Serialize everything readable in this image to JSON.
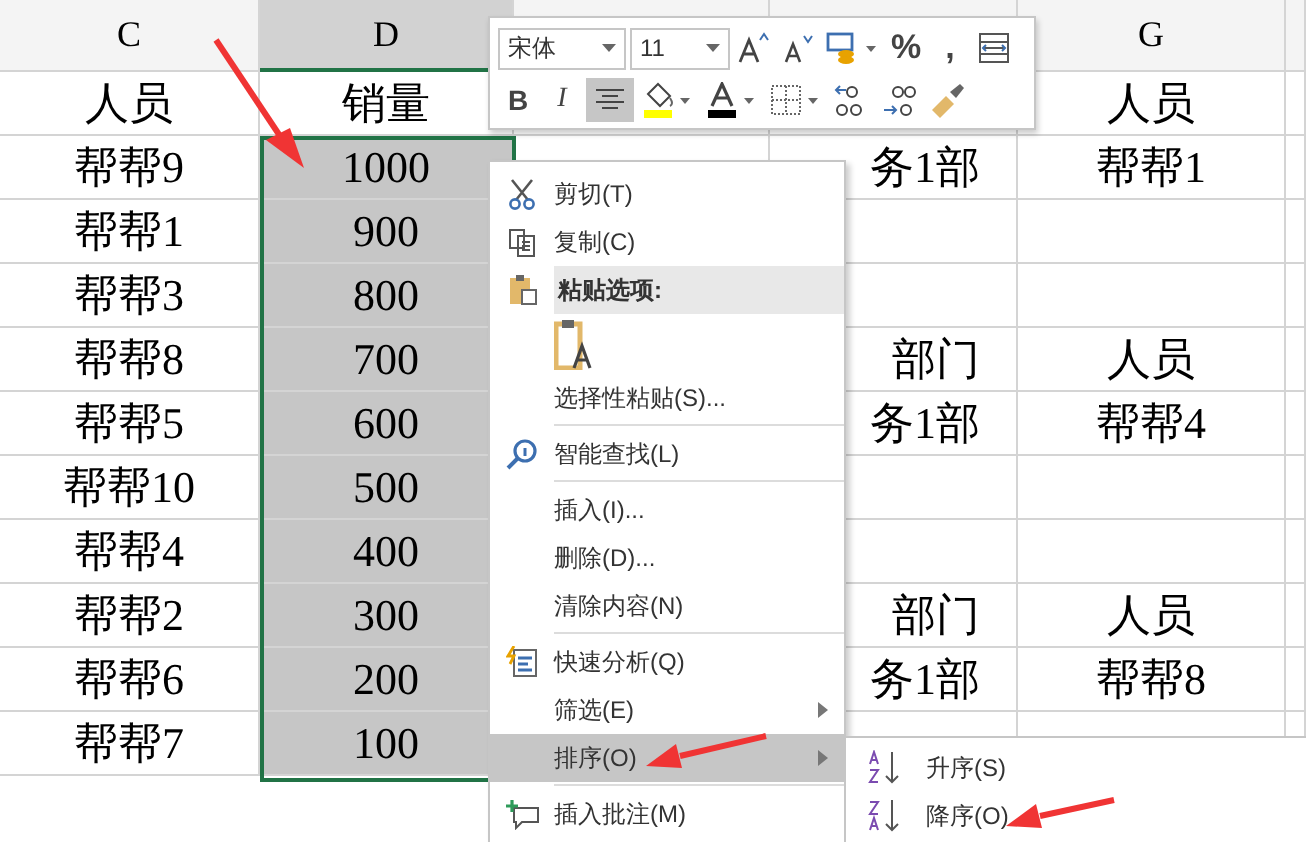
{
  "column_headers": [
    {
      "label": "C",
      "selected": false
    },
    {
      "label": "D",
      "selected": true
    },
    {
      "selected": false
    },
    {
      "selected": false
    },
    {
      "label": "G",
      "selected": false
    }
  ],
  "rows": [
    {
      "c": "人员",
      "d": "销量",
      "selected": false,
      "g": "人员"
    },
    {
      "c": "帮帮9",
      "d": "1000",
      "selected": true,
      "f": "务1部",
      "g": "帮帮1"
    },
    {
      "c": "帮帮1",
      "d": "900",
      "selected": true
    },
    {
      "c": "帮帮3",
      "d": "800",
      "selected": true
    },
    {
      "c": "帮帮8",
      "d": "700",
      "selected": true,
      "f": "部门",
      "g": "人员"
    },
    {
      "c": "帮帮5",
      "d": "600",
      "selected": true,
      "f": "务1部",
      "g": "帮帮4"
    },
    {
      "c": "帮帮10",
      "d": "500",
      "selected": true
    },
    {
      "c": "帮帮4",
      "d": "400",
      "selected": true
    },
    {
      "c": "帮帮2",
      "d": "300",
      "selected": true,
      "f": "部门",
      "g": "人员"
    },
    {
      "c": "帮帮6",
      "d": "200",
      "selected": true,
      "f": "务1部",
      "g": "帮帮8"
    },
    {
      "c": "帮帮7",
      "d": "100",
      "selected": true
    }
  ],
  "mini_toolbar": {
    "font": "宋体",
    "size": "11",
    "buttons_row_1": [
      {
        "kind": "grow-font"
      },
      {
        "kind": "shrink-font"
      },
      {
        "kind": "number-format"
      },
      {
        "kind": "text",
        "label": "%"
      },
      {
        "kind": "text",
        "label": ","
      },
      {
        "kind": "merge"
      }
    ],
    "buttons_row_2": [
      {
        "kind": "bold",
        "label": "B",
        "selected": false
      },
      {
        "kind": "italic",
        "label": "I",
        "selected": false
      },
      {
        "kind": "align",
        "selected": true
      },
      {
        "kind": "fill",
        "color": "#ffff00"
      },
      {
        "kind": "font-color",
        "color": "#000000"
      },
      {
        "kind": "borders"
      },
      {
        "kind": "inc-decimal"
      },
      {
        "kind": "dec-decimal"
      },
      {
        "kind": "painter"
      }
    ]
  },
  "context_menu": [
    {
      "kind": "cut",
      "label": "剪切(T)",
      "separator_before": false,
      "submenu": false,
      "selected": false
    },
    {
      "kind": "copy",
      "label": "复制(C)",
      "separator_before": false,
      "submenu": false,
      "selected": false
    },
    {
      "kind": "paste-header",
      "label": "粘贴选项:",
      "separator_before": false,
      "submenu": false,
      "selected": false
    },
    {
      "kind": "paste-option",
      "separator_before": false,
      "submenu": false,
      "selected": false
    },
    {
      "kind": "plain",
      "label": "选择性粘贴(S)...",
      "separator_before": false,
      "submenu": false,
      "selected": false
    },
    {
      "kind": "lookup",
      "label": "智能查找(L)",
      "separator_before": true,
      "submenu": false,
      "selected": false
    },
    {
      "kind": "plain",
      "label": "插入(I)...",
      "separator_before": true,
      "submenu": false,
      "selected": false
    },
    {
      "kind": "plain",
      "label": "删除(D)...",
      "separator_before": false,
      "submenu": false,
      "selected": false
    },
    {
      "kind": "plain",
      "label": "清除内容(N)",
      "separator_before": false,
      "submenu": false,
      "selected": false
    },
    {
      "kind": "analysis",
      "label": "快速分析(Q)",
      "separator_before": true,
      "submenu": false,
      "selected": false
    },
    {
      "kind": "plain",
      "label": "筛选(E)",
      "separator_before": false,
      "submenu": true,
      "selected": false
    },
    {
      "kind": "plain",
      "label": "排序(O)",
      "separator_before": false,
      "submenu": true,
      "selected": true
    },
    {
      "kind": "comment",
      "label": "插入批注(M)",
      "separator_before": true,
      "submenu": false,
      "selected": false
    }
  ],
  "submenu": [
    {
      "kind": "ascending",
      "label": "升序(S)",
      "selected": false
    },
    {
      "kind": "descending",
      "label": "降序(O)",
      "selected": false
    }
  ]
}
